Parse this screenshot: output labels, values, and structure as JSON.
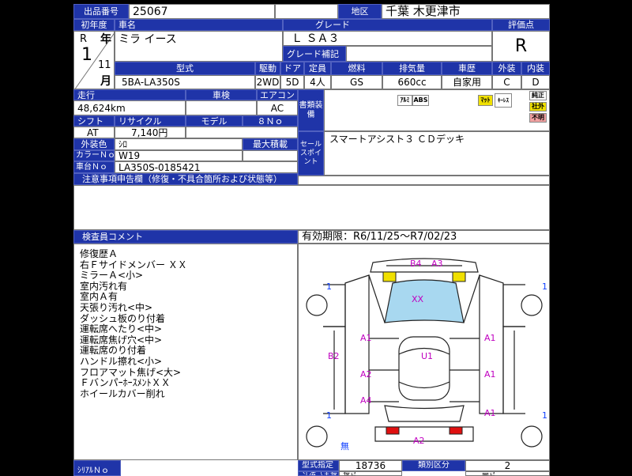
{
  "header": {
    "lot_label": "出品番号",
    "lot_value": "25067",
    "region_label": "地区",
    "region_value": "千葉 木更津市",
    "first_reg_label": "初年度",
    "car_name_label": "車名",
    "car_name": "ミラ イース",
    "grade_label": "グレード",
    "grade_value": "Ｌ ＳＡ３",
    "grade_extra_label": "グレード補記",
    "score_label": "評価点",
    "score_value": "R",
    "era": "R",
    "year_unit": "年",
    "year_value": "1",
    "month_value": "11",
    "month_unit": "月"
  },
  "spec": {
    "model_label": "型式",
    "model_value": "5BA-LA350S",
    "drive_label": "駆動",
    "drive_value": "2WD",
    "door_label": "ドア",
    "door_value": "5D",
    "capacity_label": "定員",
    "capacity_value": "4人",
    "fuel_label": "燃料",
    "fuel_value": "GS",
    "displacement_label": "排気量",
    "displacement_value": "660cc",
    "history_label": "車歴",
    "history_value": "自家用",
    "exterior_label": "外装",
    "exterior_value": "C",
    "interior_label": "内装",
    "interior_value": "D"
  },
  "details": {
    "mileage_label": "走行",
    "mileage_value": "48,624km",
    "inspection_label": "車検",
    "ac_label": "エアコン",
    "ac_value": "AC",
    "docs_label": "書類装備",
    "shift_label": "シフト",
    "shift_value": "AT",
    "recycle_label": "リサイクル",
    "recycle_value": "7,140円",
    "model_change_label": "モデル",
    "model_change_value": "８Ｎｏ",
    "color_label": "外装色",
    "color_value": "ｼﾛ",
    "max_load_label": "最大積載",
    "color_no_label": "カラーＮｏ",
    "color_no_value": "W19",
    "chassis_label": "車台Ｎｏ",
    "chassis_value": "LA350S-0185421",
    "sales_point_label": "セールスポイント",
    "sales_point_value": "スマートアシスト３ ＣＤデッキ",
    "equip_aw": "ｱﾙﾐ",
    "equip_abs": "ABS",
    "equip_mat": "ﾏｯﾄ",
    "equip_keyless": "ｷｰﾚｽ",
    "flag_genuine": "純正",
    "flag_aftermarket": "社外",
    "flag_unknown": "不明"
  },
  "notes": {
    "report_label": "注意事項申告欄（修復・不具合箇所および状態等）",
    "inspector_label": "検査員コメント",
    "validity": "有効期限：R6/11/25～R7/02/23",
    "comments": [
      "修復歴Ａ",
      "右Ｆサイドメンバー ＸＸ",
      "ミラーＡ<小>",
      "室内汚れ有",
      "室内Ａ有",
      "天張り汚れ<中>",
      "ダッシュ板のり付着",
      "運転席へたり<中>",
      "運転席焦げ穴<中>",
      "運転席のり付着",
      "ハンドル擦れ<小>",
      "フロアマット焦げ<大>",
      "ＦバンパｰﾎｰｽﾒﾝﾄＸＸ",
      "ホイールカバー削れ"
    ]
  },
  "diagram": {
    "marks": [
      "B4",
      "A3",
      "XX",
      "A1",
      "A1",
      "U1",
      "B2",
      "A2",
      "A1",
      "A4",
      "A1",
      "A2"
    ],
    "tire_marks": [
      "1",
      "1",
      "1",
      "1"
    ],
    "spare_label": "無"
  },
  "footer": {
    "type_spec_label": "型式指定",
    "type_spec_value": "18736",
    "class_label": "類別区分",
    "class_value": "2",
    "dim_label": "寸法（全長）",
    "length_label": "長さ",
    "height_label": "高さ",
    "shirial_label": "ｼﾘｱﾙＮｏ"
  },
  "colors": {
    "header_blue": "#1f34a8",
    "mark_magenta": "#c000c0",
    "windshield": "#a8d8f0",
    "yellow_mark": "#f0e000",
    "red_light": "#e01010"
  }
}
